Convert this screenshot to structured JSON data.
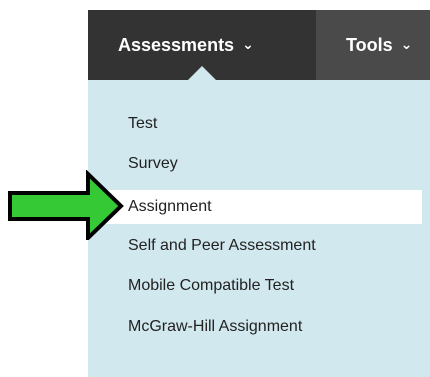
{
  "toolbar": {
    "tabs": [
      {
        "label": "Assessments",
        "active": true
      },
      {
        "label": "Tools",
        "active": false
      }
    ]
  },
  "menu": {
    "items": [
      {
        "label": "Test"
      },
      {
        "label": "Survey"
      },
      {
        "label": "Assignment",
        "highlighted": true
      },
      {
        "label": "Self and Peer Assessment"
      },
      {
        "label": "Mobile Compatible Test"
      },
      {
        "label": "McGraw-Hill Assignment"
      }
    ]
  },
  "annotation": {
    "icon": "arrow-right-icon",
    "color": "#36c936"
  },
  "colors": {
    "toolbar": "#4a4a4a",
    "active_tab": "#333333",
    "menu_bg": "#d1e8ee"
  }
}
